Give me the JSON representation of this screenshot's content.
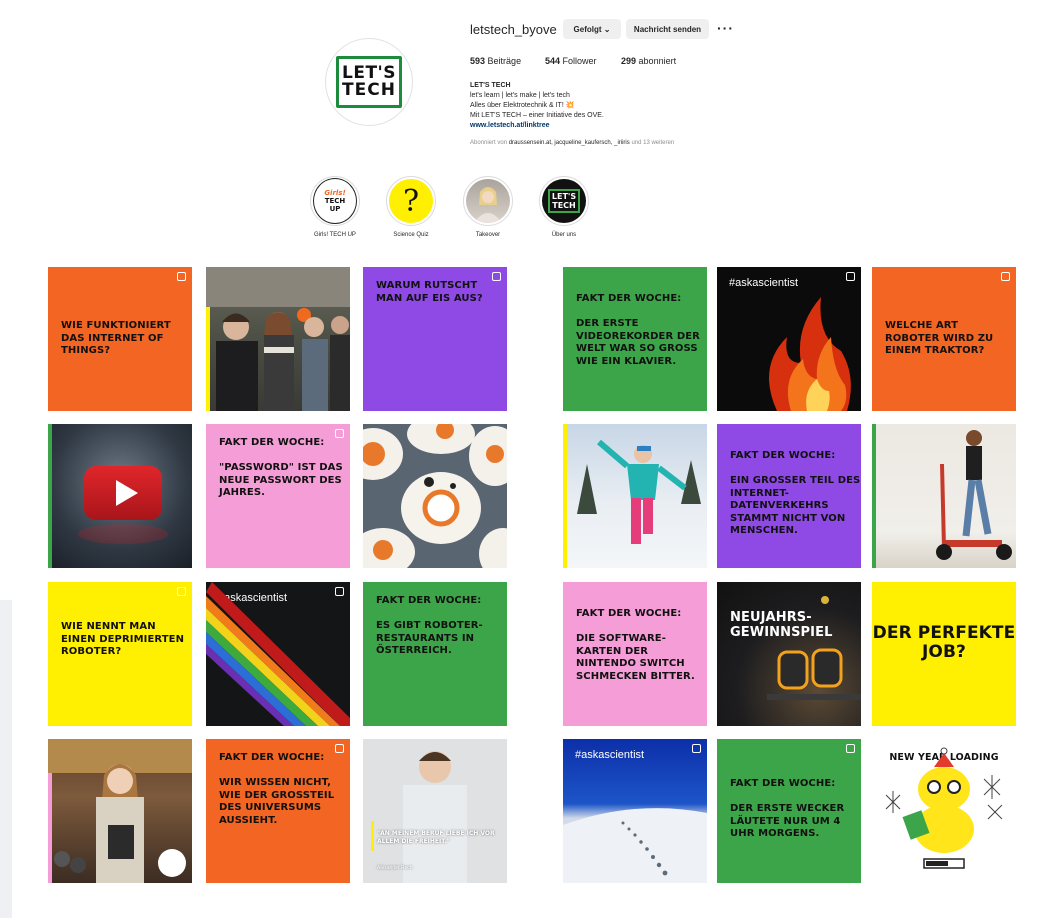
{
  "profile": {
    "username": "letstech_byove",
    "follow_button": "Gefolgt ⌄",
    "message_button": "Nachricht senden",
    "more_button": "···",
    "logo_line1": "LET'S",
    "logo_line2": "TECH",
    "posts_count": "593",
    "posts_label": "Beiträge",
    "followers_count": "544",
    "followers_label": "Follower",
    "following_count": "299",
    "following_label": "abonniert",
    "bio_name": "LET'S TECH",
    "bio_line1": "let's learn | let's make | let's tech",
    "bio_line2": "Alles über Elektrotechnik & IT! ",
    "bio_line2_emoji": "💥",
    "bio_line3": "Mit LET'S TECH – einer Initiative des OVE.",
    "bio_link": "www.letstech.at/linktree",
    "followed_by_prefix": "Abonniert von ",
    "followed_by_names": "draussensein.at, jacqueline_kaufersch, _iriiris",
    "followed_by_suffix": " und 13 weiteren"
  },
  "highlights": [
    {
      "label": "Girls! TECH UP",
      "icon": "girls-tech-up-badge",
      "badge_line1": "Girls!",
      "badge_line2": "TECH",
      "badge_line3": "UP"
    },
    {
      "label": "Science Quiz",
      "icon": "question-mark",
      "glyph": "?"
    },
    {
      "label": "Takeover",
      "icon": "person-photo"
    },
    {
      "label": "Über uns",
      "icon": "lets-tech-logo",
      "badge_line1": "LET'S",
      "badge_line2": "TECH"
    }
  ],
  "posts": [
    {
      "text": "Wie funktioniert das Internet of Things?"
    },
    {
      "text": ""
    },
    {
      "text": "Warum rutscht man auf Eis aus?"
    },
    {
      "text": "Fakt der Woche:\n\nDer erste Videorekorder der Welt war so groß wie ein Klavier."
    },
    {
      "text": "#askascientist"
    },
    {
      "text": "Welche Art Roboter wird zu einem Traktor?"
    },
    {
      "text": ""
    },
    {
      "text": "Fakt der Woche:\n\n\"Password\" ist das neue Passwort des Jahres."
    },
    {
      "text": ""
    },
    {
      "text": ""
    },
    {
      "text": "Fakt der Woche:\n\nEin großer Teil des Internet-Datenverkehrs stammt nicht von Menschen."
    },
    {
      "text": ""
    },
    {
      "text": "Wie nennt man einen deprimierten Roboter?"
    },
    {
      "text": "#askascientist"
    },
    {
      "text": "Fakt der Woche:\n\nEs gibt Roboter-Restaurants in Österreich."
    },
    {
      "text": "Fakt der Woche:\n\nDie Software-Karten der Nintendo Switch schmecken bitter."
    },
    {
      "text": "Neujahrs-Gewinnspiel"
    },
    {
      "text": "Der perfekte Job?"
    },
    {
      "text": ""
    },
    {
      "text": "Fakt der Woche:\n\nWir wissen nicht, wie der Großteil des Universums aussieht."
    },
    {
      "text": "\"An meinem Beruf liebe ich vor allem die Freiheit.\"",
      "caption": "Alexander Rech"
    },
    {
      "text": "#askascientist"
    },
    {
      "text": "Fakt der Woche:\n\nDer erste Wecker läutete nur um 4 Uhr morgens."
    },
    {
      "text": "New Year Loading"
    }
  ],
  "colors": {
    "orange": "#f26522",
    "purple": "#8f4ae6",
    "pink": "#f49dd6",
    "yellow": "#ffef00",
    "green": "#3ca549"
  }
}
